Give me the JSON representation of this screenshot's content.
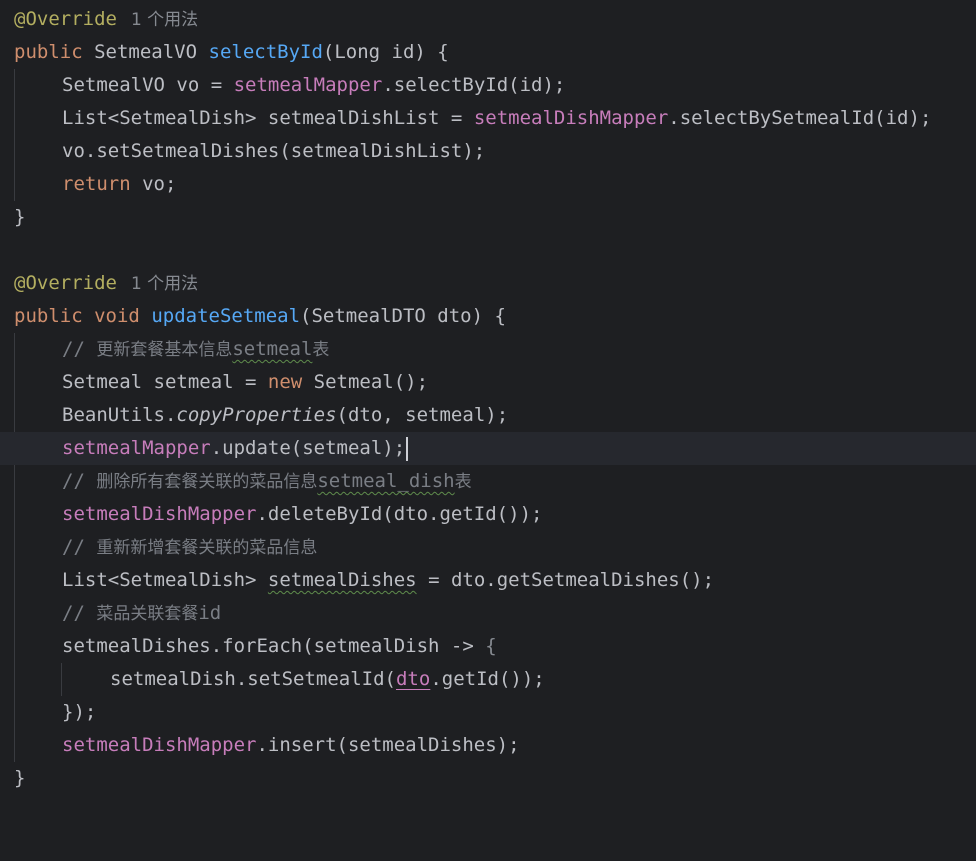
{
  "editor": {
    "usage_hint": "1 个用法",
    "method1": {
      "annotation": "@Override",
      "kw_public": "public",
      "return_type": "SetmealVO",
      "name": "selectById",
      "params": "(Long id) {",
      "l1_a": "SetmealVO vo = ",
      "l1_field": "setmealMapper",
      "l1_b": ".selectById(id);",
      "l2_a": "List<SetmealDish> setmealDishList = ",
      "l2_field": "setmealDishMapper",
      "l2_b": ".selectBySetmealId(id);",
      "l3": "vo.setSetmealDishes(setmealDishList);",
      "l4_kw": "return",
      "l4_b": " vo;",
      "close": "}"
    },
    "method2": {
      "annotation": "@Override",
      "kw_public": "public",
      "kw_void": "void",
      "name": "updateSetmeal",
      "params": "(SetmealDTO dto) {",
      "c1_prefix": "// ",
      "c1_cjk": "更新套餐基本信息",
      "c1_word": "setmeal",
      "c1_suffix": "表",
      "l1_a": "Setmeal setmeal = ",
      "l1_kw": "new",
      "l1_b": " Setmeal();",
      "l2_a": "BeanUtils.",
      "l2_italic": "copyProperties",
      "l2_b": "(dto, setmeal);",
      "l3_field": "setmealMapper",
      "l3_b": ".update(setmeal);",
      "c2_prefix": "// ",
      "c2_cjk": "删除所有套餐关联的菜品信息",
      "c2_word": "setmeal_dish",
      "c2_suffix": "表",
      "l4_field": "setmealDishMapper",
      "l4_b": ".deleteById(dto.getId());",
      "c3_prefix": "// ",
      "c3_cjk": "重新新增套餐关联的菜品信息",
      "l5_a": "List<SetmealDish> ",
      "l5_var": "setmealDishes",
      "l5_b": " = dto.getSetmealDishes();",
      "c4_prefix": "// ",
      "c4_cjk": "菜品关联套餐",
      "c4_word": "id",
      "l6_a": "setmealDishes.forEach(setmealDish -> ",
      "l6_brace": "{",
      "l7_a": "setmealDish.setSetmealId(",
      "l7_ref": "dto",
      "l7_b": ".getId());",
      "l8": "});",
      "l9_field": "setmealDishMapper",
      "l9_b": ".insert(setmealDishes);",
      "close": "}"
    }
  },
  "colors": {
    "background": "#1e1f22",
    "current_line": "#26282e",
    "default_text": "#bcbec4",
    "keyword": "#cf8e6d",
    "method_declaration": "#56a8f5",
    "field": "#c77dbb",
    "annotation": "#b3ae60",
    "comment": "#7a7e85",
    "hint": "#868a91"
  }
}
